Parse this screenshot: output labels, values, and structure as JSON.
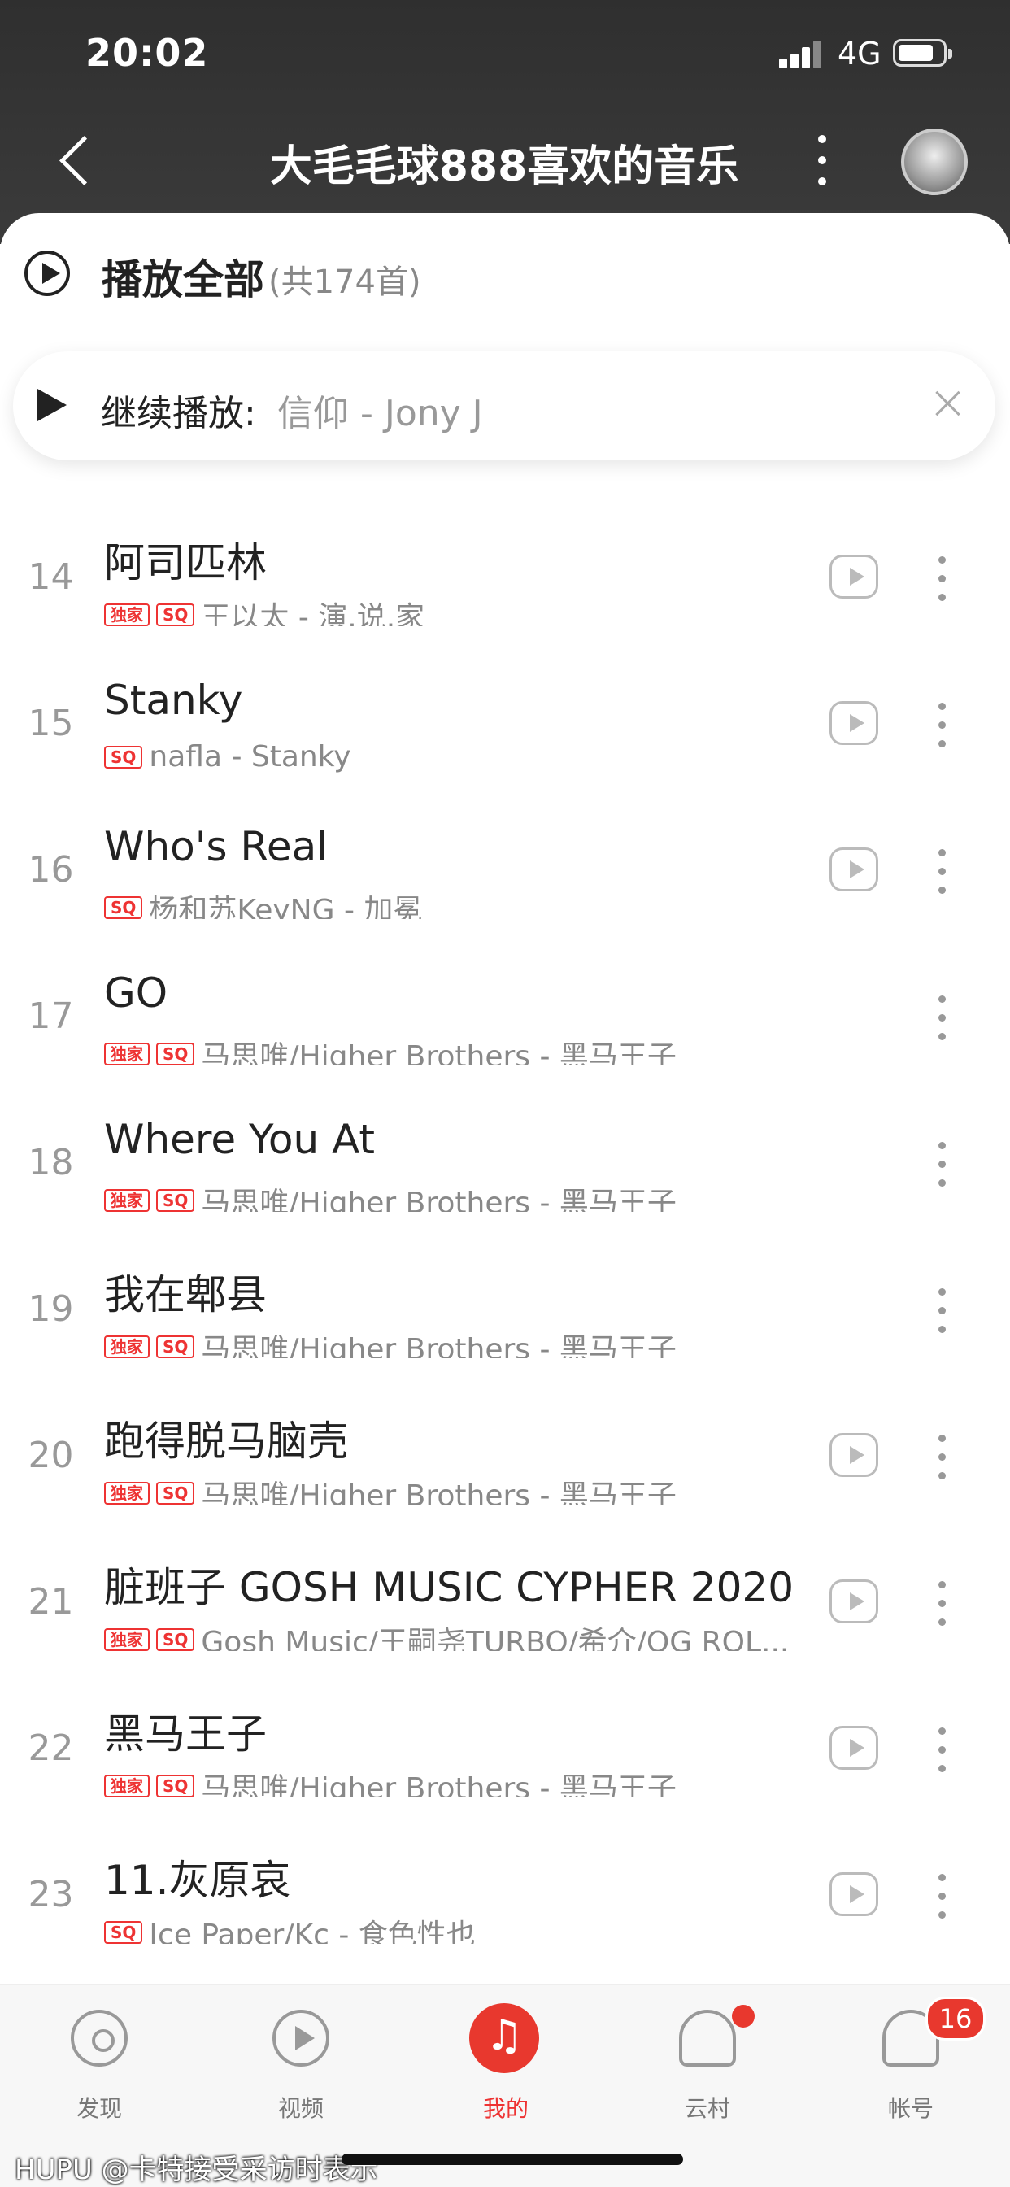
{
  "status_bar": {
    "time": "20:02",
    "network": "4G"
  },
  "nav": {
    "title": "大毛毛球888喜欢的音乐"
  },
  "play_all": {
    "label": "播放全部",
    "count": "(共174首)"
  },
  "continue_bar": {
    "label": "继续播放:",
    "song": "信仰 - Jony J"
  },
  "songs": [
    {
      "num": "14",
      "title": "阿司匹林",
      "badges": [
        "独家",
        "SQ"
      ],
      "artist": "王以太 - 演.说.家",
      "mv": true
    },
    {
      "num": "15",
      "title": "Stanky",
      "badges": [
        "SQ"
      ],
      "artist": "nafla - Stanky",
      "mv": true
    },
    {
      "num": "16",
      "title": "Who's Real",
      "badges": [
        "SQ"
      ],
      "artist": "杨和苏KeyNG - 加冕",
      "mv": true
    },
    {
      "num": "17",
      "title": "GO",
      "badges": [
        "独家",
        "SQ"
      ],
      "artist": "马思唯/Higher Brothers - 黑马王子",
      "mv": false
    },
    {
      "num": "18",
      "title": "Where You At",
      "badges": [
        "独家",
        "SQ"
      ],
      "artist": "马思唯/Higher Brothers - 黑马王子",
      "mv": false
    },
    {
      "num": "19",
      "title": "我在郫县",
      "badges": [
        "独家",
        "SQ"
      ],
      "artist": "马思唯/Higher Brothers - 黑马王子",
      "mv": false
    },
    {
      "num": "20",
      "title": "跑得脱马脑壳",
      "badges": [
        "独家",
        "SQ"
      ],
      "artist": "马思唯/Higher Brothers - 黑马王子",
      "mv": true
    },
    {
      "num": "21",
      "title": "脏班子 GOSH MUSIC CYPHER 2020",
      "badges": [
        "独家",
        "SQ"
      ],
      "artist": "Gosh Music/王嗣尧TURBO/希介/OG ROL...",
      "mv": true
    },
    {
      "num": "22",
      "title": "黑马王子",
      "badges": [
        "独家",
        "SQ"
      ],
      "artist": "马思唯/Higher Brothers - 黑马王子",
      "mv": true
    },
    {
      "num": "23",
      "title": "11.灰原哀",
      "badges": [
        "SQ"
      ],
      "artist": "Ice Paper/Kc - 食色性也",
      "mv": true
    }
  ],
  "tabs": [
    {
      "label": "发现",
      "icon": "discover-icon",
      "active": false
    },
    {
      "label": "视频",
      "icon": "video-icon",
      "active": false
    },
    {
      "label": "我的",
      "icon": "music-note-icon",
      "active": true
    },
    {
      "label": "云村",
      "icon": "cloud-village-icon",
      "active": false,
      "dot": true
    },
    {
      "label": "帐号",
      "icon": "account-icon",
      "active": false,
      "badge": "16"
    }
  ],
  "watermark": "HUPU @卡特接受采访时表示",
  "colors": {
    "accent": "#e8382e",
    "header_bg": "#333333"
  }
}
